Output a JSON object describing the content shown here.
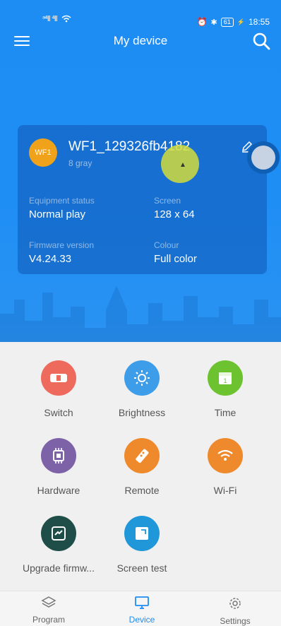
{
  "status_bar": {
    "time": "18:55",
    "battery": "61",
    "signal": "ᵃ⁴ll ⁴ll"
  },
  "header": {
    "title": "My device"
  },
  "device": {
    "badge": "WF1",
    "name": "WF1_129326fb4182",
    "subtitle": "8 gray",
    "equipment_status_label": "Equipment status",
    "equipment_status_value": "Normal play",
    "screen_label": "Screen",
    "screen_value": "128 x 64",
    "firmware_label": "Firmware version",
    "firmware_value": "V4.24.33",
    "colour_label": "Colour",
    "colour_value": "Full color"
  },
  "functions": [
    {
      "label": "Switch",
      "icon": "switch-icon",
      "color": "#ee6a5d"
    },
    {
      "label": "Brightness",
      "icon": "sun-icon",
      "color": "#3e9de8"
    },
    {
      "label": "Time",
      "icon": "calendar-icon",
      "color": "#6cc32f"
    },
    {
      "label": "Hardware",
      "icon": "chip-icon",
      "color": "#7e62a8"
    },
    {
      "label": "Remote",
      "icon": "remote-icon",
      "color": "#ef8a2c"
    },
    {
      "label": "Wi-Fi",
      "icon": "wifi-icon",
      "color": "#ef8a2c"
    },
    {
      "label": "Upgrade firmw...",
      "icon": "upgrade-icon",
      "color": "#1f4e48"
    },
    {
      "label": "Screen test",
      "icon": "screen-test-icon",
      "color": "#1f97d8"
    }
  ],
  "nav": {
    "program": "Program",
    "device": "Device",
    "settings": "Settings",
    "active": "Device",
    "active_color": "#1e8df3"
  },
  "colors": {
    "header_blue": "#1e8df3",
    "badge_orange": "#f0a21a"
  }
}
